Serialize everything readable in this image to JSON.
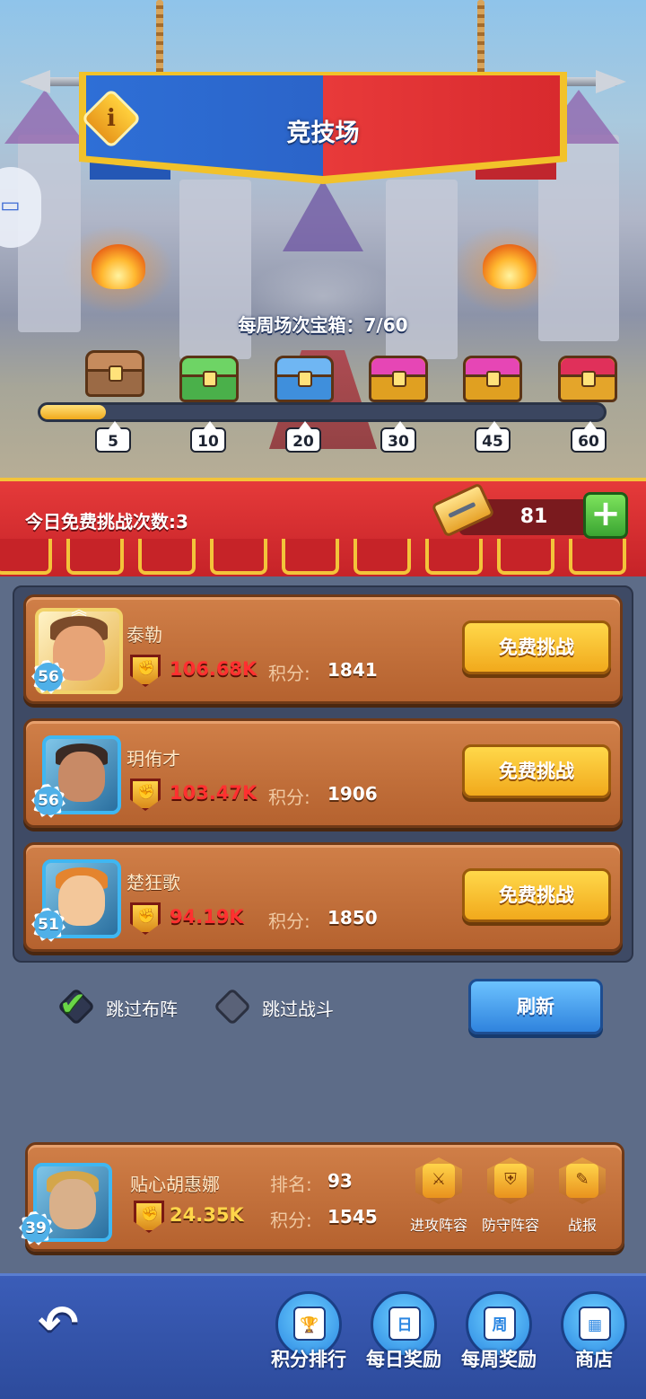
{
  "header": {
    "title": "竞技场",
    "info_icon": "info-icon",
    "chat_icon": "chat-bubble-icon"
  },
  "weekly_chests": {
    "label": "每周场次宝箱：",
    "progress_text": "7/60",
    "progress_fraction": 0.117,
    "milestones": [
      "5",
      "10",
      "20",
      "30",
      "45",
      "60"
    ],
    "chest_types": [
      "wood-chest-icon",
      "green-chest-icon",
      "blue-chest-icon",
      "pink-chest-icon",
      "pink-chest-icon",
      "ruby-chest-icon"
    ]
  },
  "tickets": {
    "free_challenges_label": "今日免费挑战次数:3",
    "ticket_count": "81",
    "add_icon": "plus-icon"
  },
  "opponents": [
    {
      "name": "泰勒",
      "level": "56",
      "power": "106.68K",
      "score_label": "积分:",
      "score": "1841",
      "button": "免费挑战",
      "frame": "winged"
    },
    {
      "name": "玥侑才",
      "level": "56",
      "power": "103.47K",
      "score_label": "积分:",
      "score": "1906",
      "button": "免费挑战",
      "frame": "blue"
    },
    {
      "name": "楚狂歌",
      "level": "51",
      "power": "94.19K",
      "score_label": "积分:",
      "score": "1850",
      "button": "免费挑战",
      "frame": "blue"
    }
  ],
  "options": {
    "skip_formation": {
      "label": "跳过布阵",
      "checked": true
    },
    "skip_battle": {
      "label": "跳过战斗",
      "checked": false
    },
    "refresh": "刷新"
  },
  "me": {
    "name": "贴心胡惠娜",
    "level": "39",
    "power": "24.35K",
    "rank_label": "排名:",
    "rank": "93",
    "score_label": "积分:",
    "score": "1545",
    "actions": [
      "进攻阵容",
      "防守阵容",
      "战报"
    ]
  },
  "bottom_nav": {
    "back_icon": "undo-arrow-icon",
    "items": [
      {
        "label": "积分排行",
        "icon": "trophy-icon",
        "glyph": "🏆"
      },
      {
        "label": "每日奖励",
        "icon": "daily-gift-icon",
        "glyph": "日"
      },
      {
        "label": "每周奖励",
        "icon": "weekly-gift-icon",
        "glyph": "周"
      },
      {
        "label": "商店",
        "icon": "shop-icon",
        "glyph": "▦"
      }
    ]
  },
  "colors": {
    "banner_blue": "#2e6fd6",
    "banner_red": "#e83a3a",
    "power_red": "#ff3030",
    "gold_button": "#f1a91c",
    "refresh_blue": "#2f83dd"
  }
}
